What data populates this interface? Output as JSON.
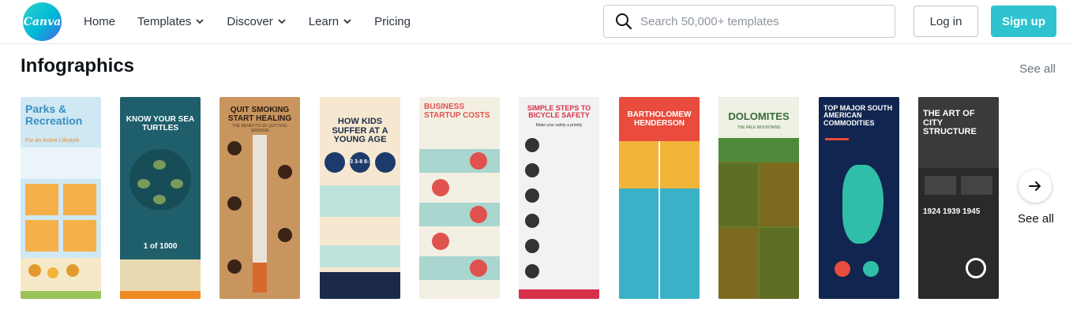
{
  "header": {
    "logo_text": "Canva",
    "nav": [
      {
        "label": "Home",
        "has_dropdown": false
      },
      {
        "label": "Templates",
        "has_dropdown": true
      },
      {
        "label": "Discover",
        "has_dropdown": true
      },
      {
        "label": "Learn",
        "has_dropdown": true
      },
      {
        "label": "Pricing",
        "has_dropdown": false
      }
    ],
    "search": {
      "placeholder": "Search 50,000+ templates",
      "value": "",
      "icon": "search-icon"
    },
    "login_label": "Log in",
    "signup_label": "Sign up",
    "accent": "#2ec3cf"
  },
  "section": {
    "title": "Infographics",
    "see_all_label": "See all",
    "side_see_all_label": "See all",
    "next_icon": "arrow-right-icon"
  },
  "cards": [
    {
      "title": "Parks & Recreation",
      "subtitle": "For an Active Lifestyle",
      "bg": "#c9e6f2",
      "title_color": "#3b8fc4"
    },
    {
      "title": "KNOW YOUR SEA TURTLES",
      "subtitle": "1 of 1000",
      "bg": "#1e5f6b",
      "title_color": "#ffffff"
    },
    {
      "title": "QUIT SMOKING START HEALING",
      "subtitle": "THE BENEFITS OF QUITTING SMOKING",
      "bg": "#c8955f",
      "title_color": "#2a1a10"
    },
    {
      "title": "HOW KIDS SUFFER AT A YOUNG AGE",
      "subtitle": "0-3  3-8  8-15",
      "bg": "#f6e8d0",
      "title_color": "#1c2a4a"
    },
    {
      "title": "BUSINESS STARTUP COSTS",
      "subtitle": "",
      "bg": "#f4efe3",
      "title_color": "#e0524e"
    },
    {
      "title": "SIMPLE STEPS TO BICYCLE SAFETY",
      "subtitle": "Make your safety a priority",
      "bg": "#f2f2f2",
      "title_color": "#d6304a"
    },
    {
      "title": "BARTHOLOMEW HENDERSON",
      "subtitle": "",
      "bg": "#f3b43a",
      "title_color": "#ffffff"
    },
    {
      "title": "DOLOMITES",
      "subtitle": "THE PALE MOUNTAINS",
      "bg": "#6a7a2b",
      "title_color": "#3a6b3a"
    },
    {
      "title": "TOP MAJOR SOUTH AMERICAN COMMODITIES",
      "subtitle": "",
      "bg": "#10254f",
      "title_color": "#ffffff"
    },
    {
      "title": "THE ART OF CITY STRUCTURE",
      "subtitle": "1924  1939  1945",
      "bg": "#2a2a2a",
      "title_color": "#ffffff"
    }
  ]
}
